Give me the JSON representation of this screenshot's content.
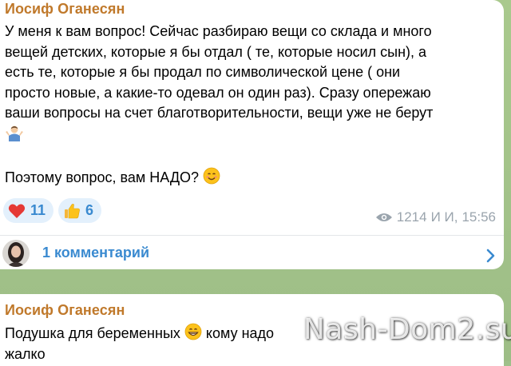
{
  "messages": [
    {
      "sender": "Иосиф Оганесян",
      "lines": [
        "У меня к вам вопрос! Сейчас разбираю вещи со склада и много",
        "вещей детских, которые я бы отдал ( те, которые носил сын), а",
        "есть те, которые я бы продал по символической цене ( они",
        "просто новые, а какие-то одевал он один раз). Сразу опережаю",
        "ваши вопросы на счет благотворительности, вещи уже не берут"
      ],
      "question": "Поэтому вопрос, вам НАДО?",
      "reactions": [
        {
          "icon": "heart-icon",
          "count": "11"
        },
        {
          "icon": "thumbs-up-icon",
          "count": "6"
        }
      ],
      "views": "1214",
      "author_short": "И И,",
      "time": "15:56",
      "comments_label": "1 комментарий"
    },
    {
      "sender": "Иосиф Оганесян",
      "line1_start": "Подушка для беременных",
      "line1_end": "кому надо",
      "line2": "жалко"
    }
  ],
  "watermark": "Nash-Dom2.su",
  "colors": {
    "sender": "#c0792b",
    "link": "#3a8ad0",
    "reaction_bg": "#e3f0fc",
    "meta": "#9aa4ad",
    "chat_bg": "#a9c98d"
  }
}
